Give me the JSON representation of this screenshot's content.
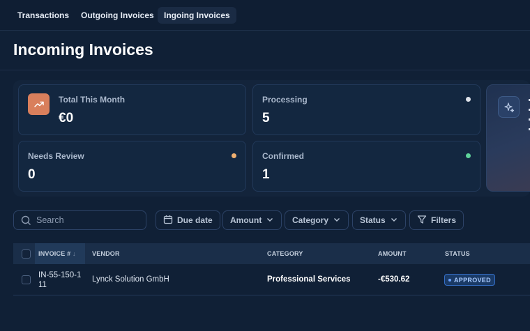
{
  "tabs": [
    {
      "label": "Transactions",
      "active": false
    },
    {
      "label": "Outgoing Invoices",
      "active": false
    },
    {
      "label": "Ingoing Invoices",
      "active": true
    }
  ],
  "page": {
    "title": "Incoming Invoices"
  },
  "stats": {
    "total_month": {
      "label": "Total This Month",
      "value": "€0",
      "icon": "trending-up-icon"
    },
    "processing": {
      "label": "Processing",
      "value": "5",
      "dot_color": "#dfe3ea"
    },
    "needs_review": {
      "label": "Needs Review",
      "value": "0",
      "dot_color": "#f0b070"
    },
    "confirmed": {
      "label": "Confirmed",
      "value": "1",
      "dot_color": "#5fd39a"
    }
  },
  "side_card": {
    "icon": "sparkles-icon"
  },
  "filters": {
    "search_placeholder": "Search",
    "due_date": "Due date",
    "amount": "Amount",
    "category": "Category",
    "status": "Status",
    "more": "Filters"
  },
  "table": {
    "columns": {
      "invoice": "INVOICE #",
      "vendor": "VENDOR",
      "category": "CATEGORY",
      "amount": "AMOUNT",
      "status": "STATUS"
    },
    "rows": [
      {
        "invoice_line1": "IN-55-150-1",
        "invoice_line2": "11",
        "vendor": "Lynck Solution GmbH",
        "category": "Professional Services",
        "amount": "-€530.62",
        "status": "APPROVED"
      }
    ]
  },
  "colors": {
    "background": "#102036",
    "accent_orange": "#d97f5c",
    "approved": "#3570c9"
  }
}
